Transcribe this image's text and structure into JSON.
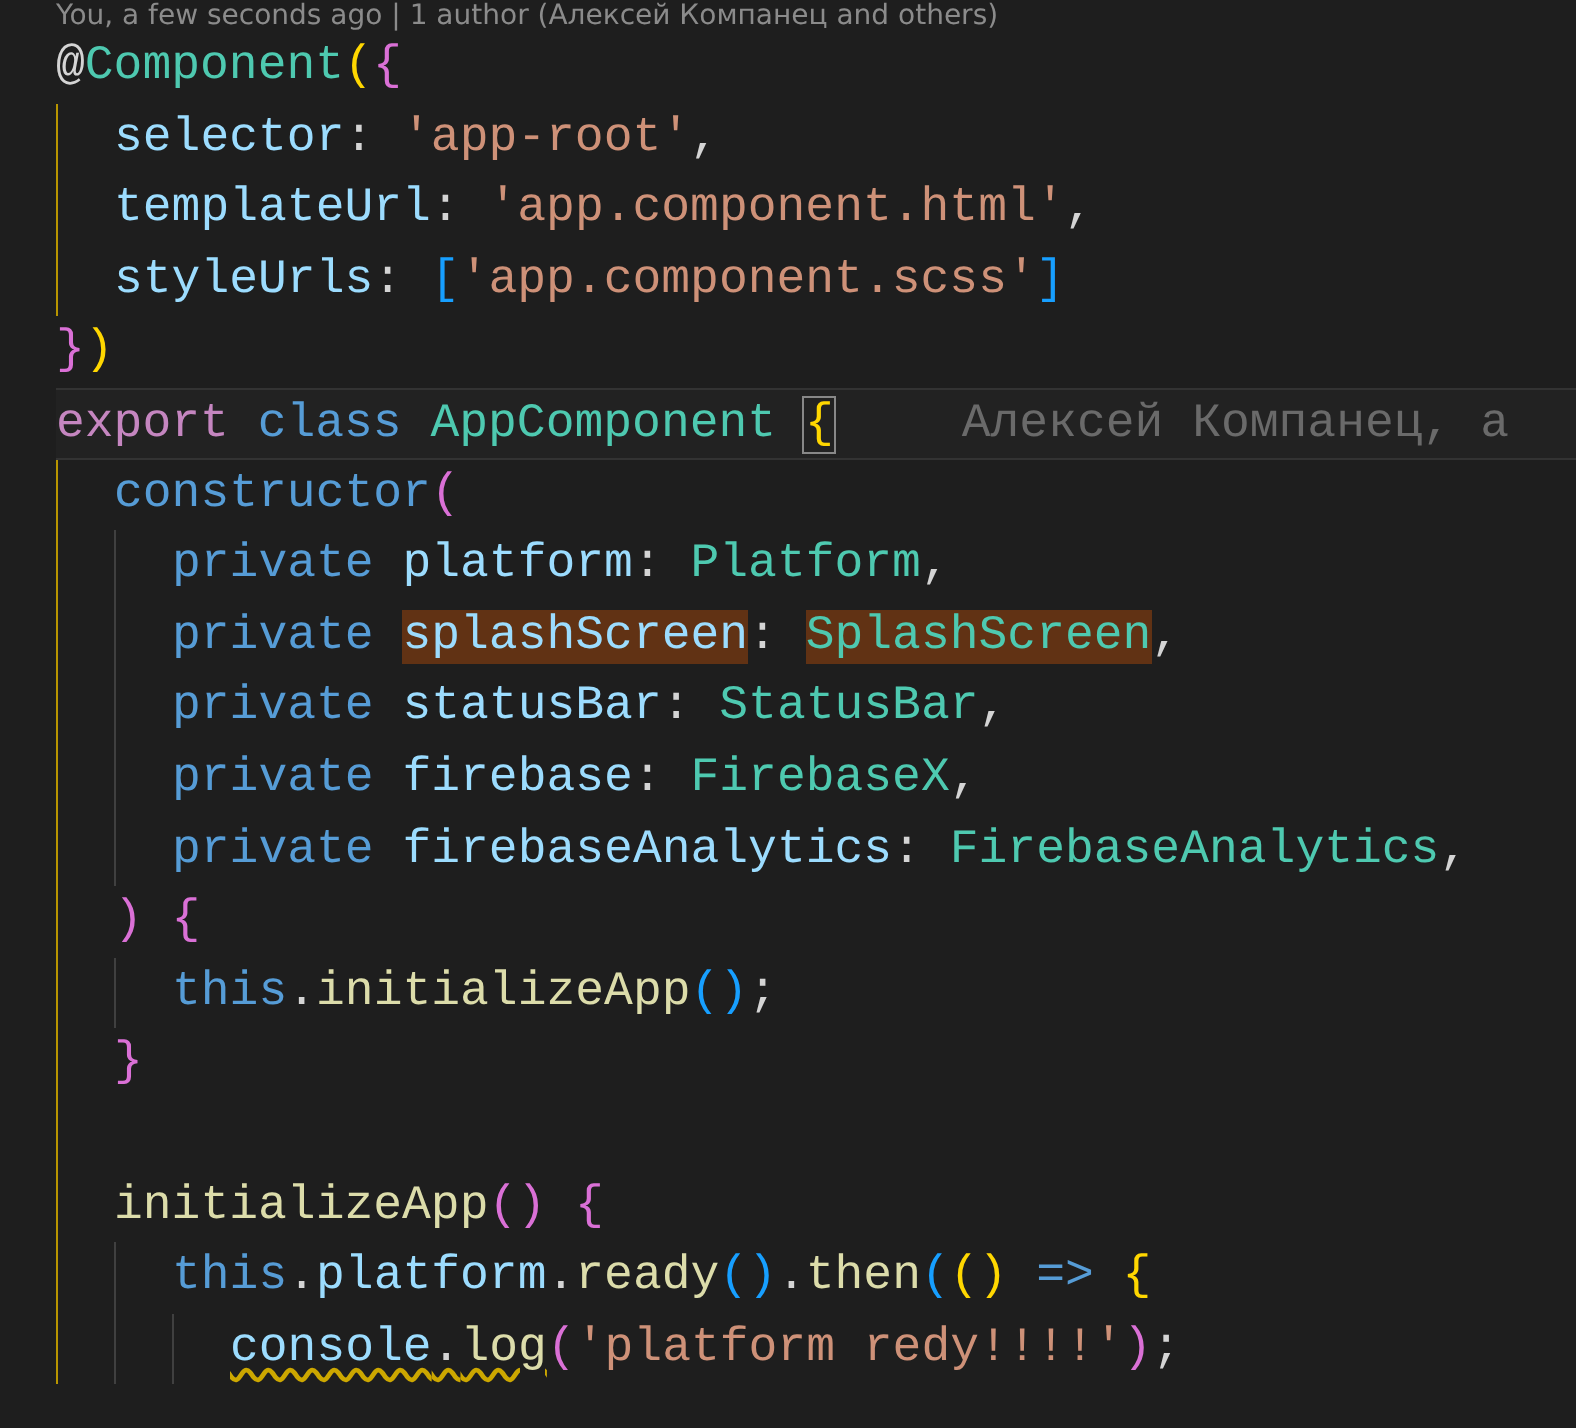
{
  "blame_header": "You, a few seconds ago | 1 author (Алексей Компанец and others)",
  "lines": [
    {
      "tokens": [
        {
          "text": "@",
          "kind": "punct"
        },
        {
          "text": "Component",
          "kind": "type"
        },
        {
          "text": "(",
          "kind": "bracket1"
        },
        {
          "text": "{",
          "kind": "bracket2"
        }
      ],
      "children": [
        {
          "tokens": [
            {
              "text": "selector",
              "kind": "prop"
            },
            {
              "text": ":",
              "kind": "punct"
            },
            {
              "text": "'app-root'",
              "kind": "string",
              "space_before": true
            },
            {
              "text": ",",
              "kind": "punct"
            }
          ]
        },
        {
          "tokens": [
            {
              "text": "templateUrl",
              "kind": "prop"
            },
            {
              "text": ":",
              "kind": "punct"
            },
            {
              "text": "'app.component.html'",
              "kind": "string",
              "space_before": true
            },
            {
              "text": ",",
              "kind": "punct"
            }
          ]
        },
        {
          "tokens": [
            {
              "text": "styleUrls",
              "kind": "prop"
            },
            {
              "text": ":",
              "kind": "punct"
            },
            {
              "text": "[",
              "kind": "bracket3",
              "space_before": true
            },
            {
              "text": "'app.component.scss'",
              "kind": "string"
            },
            {
              "text": "]",
              "kind": "bracket3"
            }
          ]
        }
      ]
    },
    {
      "tokens": [
        {
          "text": "}",
          "kind": "bracket2"
        },
        {
          "text": ")",
          "kind": "bracket1"
        }
      ]
    },
    {
      "current": true,
      "blame": "Алексей Компанец, а",
      "tokens": [
        {
          "text": "export",
          "kind": "keyword"
        },
        {
          "text": "class",
          "kind": "storage",
          "space_before": true
        },
        {
          "text": "AppComponent",
          "kind": "type",
          "space_before": true
        },
        {
          "text": "{",
          "kind": "bracket1",
          "matched": true,
          "space_before": true
        }
      ],
      "children": [
        {
          "tokens": [
            {
              "text": "constructor",
              "kind": "storage"
            },
            {
              "text": "(",
              "kind": "bracket2"
            }
          ],
          "children": [
            {
              "tokens": [
                {
                  "text": "private",
                  "kind": "storage"
                },
                {
                  "text": "platform",
                  "kind": "prop",
                  "space_before": true
                },
                {
                  "text": ":",
                  "kind": "punct"
                },
                {
                  "text": "Platform",
                  "kind": "type",
                  "space_before": true
                },
                {
                  "text": ",",
                  "kind": "punct"
                }
              ]
            },
            {
              "tokens": [
                {
                  "text": "private",
                  "kind": "storage"
                },
                {
                  "text": "splashScreen",
                  "kind": "prop",
                  "highlighted": true,
                  "space_before": true
                },
                {
                  "text": ":",
                  "kind": "punct"
                },
                {
                  "text": "SplashScreen",
                  "kind": "type",
                  "highlighted": true,
                  "space_before": true
                },
                {
                  "text": ",",
                  "kind": "punct"
                }
              ]
            },
            {
              "tokens": [
                {
                  "text": "private",
                  "kind": "storage"
                },
                {
                  "text": "statusBar",
                  "kind": "prop",
                  "space_before": true
                },
                {
                  "text": ":",
                  "kind": "punct"
                },
                {
                  "text": "StatusBar",
                  "kind": "type",
                  "space_before": true
                },
                {
                  "text": ",",
                  "kind": "punct"
                }
              ]
            },
            {
              "tokens": [
                {
                  "text": "private",
                  "kind": "storage"
                },
                {
                  "text": "firebase",
                  "kind": "prop",
                  "space_before": true
                },
                {
                  "text": ":",
                  "kind": "punct"
                },
                {
                  "text": "FirebaseX",
                  "kind": "type",
                  "space_before": true
                },
                {
                  "text": ",",
                  "kind": "punct"
                }
              ]
            },
            {
              "tokens": [
                {
                  "text": "private",
                  "kind": "storage"
                },
                {
                  "text": "firebaseAnalytics",
                  "kind": "prop",
                  "space_before": true
                },
                {
                  "text": ":",
                  "kind": "punct"
                },
                {
                  "text": "FirebaseAnalytics",
                  "kind": "type",
                  "space_before": true
                },
                {
                  "text": ",",
                  "kind": "punct"
                }
              ]
            }
          ]
        },
        {
          "tokens": [
            {
              "text": ")",
              "kind": "bracket2"
            },
            {
              "text": "{",
              "kind": "bracket2",
              "space_before": true
            }
          ],
          "children": [
            {
              "tokens": [
                {
                  "text": "this",
                  "kind": "storage"
                },
                {
                  "text": ".",
                  "kind": "punct"
                },
                {
                  "text": "initializeApp",
                  "kind": "func"
                },
                {
                  "text": "()",
                  "kind": "bracket3"
                },
                {
                  "text": ";",
                  "kind": "punct"
                }
              ]
            }
          ]
        },
        {
          "tokens": [
            {
              "text": "}",
              "kind": "bracket2"
            }
          ]
        },
        {
          "kind": "blank"
        },
        {
          "tokens": [
            {
              "text": "initializeApp",
              "kind": "func"
            },
            {
              "text": "()",
              "kind": "bracket2"
            },
            {
              "text": "{",
              "kind": "bracket2",
              "space_before": true
            }
          ],
          "children": [
            {
              "tokens": [
                {
                  "text": "this",
                  "kind": "storage"
                },
                {
                  "text": ".",
                  "kind": "punct"
                },
                {
                  "text": "platform",
                  "kind": "prop"
                },
                {
                  "text": ".",
                  "kind": "punct"
                },
                {
                  "text": "ready",
                  "kind": "func"
                },
                {
                  "text": "()",
                  "kind": "bracket3"
                },
                {
                  "text": ".",
                  "kind": "punct"
                },
                {
                  "text": "then",
                  "kind": "func"
                },
                {
                  "text": "(",
                  "kind": "bracket3"
                },
                {
                  "text": "()",
                  "kind": "bracket1"
                },
                {
                  "text": "=>",
                  "kind": "storage",
                  "space_before": true
                },
                {
                  "text": "{",
                  "kind": "bracket1",
                  "space_before": true
                }
              ],
              "children": [
                {
                  "tokens": [
                    {
                      "text": "console",
                      "kind": "prop",
                      "warning": true
                    },
                    {
                      "text": ".",
                      "kind": "punct",
                      "warning": true
                    },
                    {
                      "text": "log",
                      "kind": "func",
                      "warning": true
                    },
                    {
                      "text": "(",
                      "kind": "bracket2"
                    },
                    {
                      "text": "'platform redy!!!!'",
                      "kind": "string"
                    },
                    {
                      "text": ")",
                      "kind": "bracket2"
                    },
                    {
                      "text": ";",
                      "kind": "punct"
                    }
                  ]
                }
              ]
            }
          ]
        }
      ]
    }
  ]
}
